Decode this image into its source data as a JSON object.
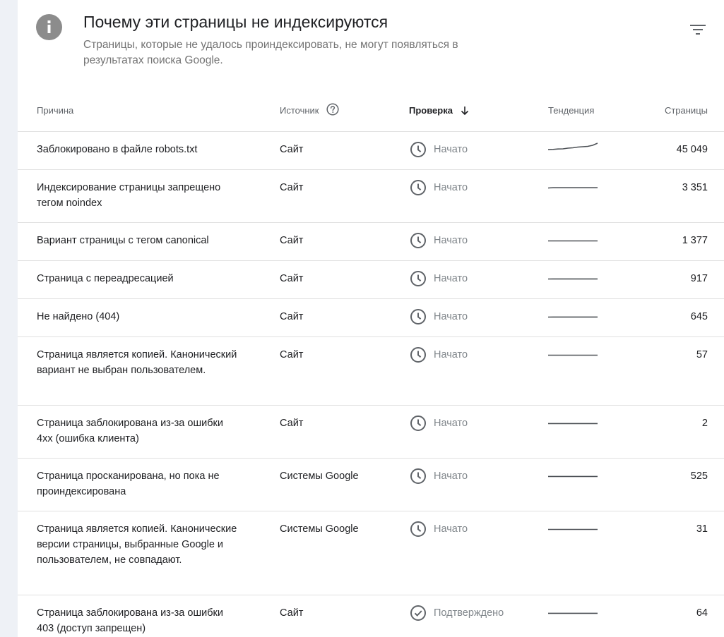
{
  "header": {
    "title": "Почему эти страницы не индексируются",
    "subtitle": "Страницы, которые не удалось проиндексировать, не могут появляться в результатах поиска Google."
  },
  "columns": {
    "reason": "Причина",
    "source": "Источник",
    "check": "Проверка",
    "trend": "Тенденция",
    "pages": "Страницы"
  },
  "colors": {
    "page_bg": "#eef1f6",
    "card_bg": "#ffffff",
    "icon_gray": "#5f6368",
    "trend_line": "#4d5156",
    "divider": "#e0e0e0"
  },
  "rows": [
    {
      "reason": "Заблокировано в файле robots.txt",
      "source": "Сайт",
      "status": "Начато",
      "status_icon": "clock-icon",
      "trend": [
        0.08,
        0.12,
        0.18,
        0.2,
        0.3,
        0.35,
        0.45,
        0.5,
        0.55,
        0.7,
        1.0
      ],
      "pages": "45 049"
    },
    {
      "reason": "Индексирование страницы запрещено тегом noindex",
      "source": "Сайт",
      "status": "Начато",
      "status_icon": "clock-icon",
      "trend": [
        0.05,
        0.1,
        0.1,
        0.1,
        0.1,
        0.1,
        0.1,
        0.1,
        0.1,
        0.1,
        0.1
      ],
      "pages": "3 351"
    },
    {
      "reason": "Вариант страницы с тегом canonical",
      "source": "Сайт",
      "status": "Начато",
      "status_icon": "clock-icon",
      "trend": [
        0.05,
        0.05,
        0.05,
        0.05,
        0.05,
        0.05,
        0.05,
        0.05,
        0.05,
        0.05,
        0.05
      ],
      "pages": "1 377"
    },
    {
      "reason": "Страница с переадресацией",
      "source": "Сайт",
      "status": "Начато",
      "status_icon": "clock-icon",
      "trend": [
        0.05,
        0.06,
        0.06,
        0.06,
        0.06,
        0.06,
        0.06,
        0.06,
        0.06,
        0.06,
        0.06
      ],
      "pages": "917"
    },
    {
      "reason": "Не найдено (404)",
      "source": "Сайт",
      "status": "Начато",
      "status_icon": "clock-icon",
      "trend": [
        0.05,
        0.06,
        0.06,
        0.06,
        0.06,
        0.06,
        0.06,
        0.06,
        0.06,
        0.06,
        0.06
      ],
      "pages": "645"
    },
    {
      "reason": "Страница является копией. Канонический вариант не выбран пользователем.",
      "source": "Сайт",
      "status": "Начато",
      "status_icon": "clock-icon",
      "trend": [
        0.05,
        0.05,
        0.05,
        0.05,
        0.05,
        0.05,
        0.05,
        0.05,
        0.05,
        0.05,
        0.05
      ],
      "pages": "57"
    },
    {
      "reason": "Страница заблокирована из-за ошибки 4xx (ошибка клиента)",
      "source": "Сайт",
      "status": "Начато",
      "status_icon": "clock-icon",
      "trend": [
        0.06,
        0.06,
        0.06,
        0.06,
        0.06,
        0.06,
        0.06,
        0.06,
        0.06,
        0.06,
        0.06
      ],
      "pages": "2"
    },
    {
      "reason": "Страница просканирована, но пока не проиндексирована",
      "source": "Системы Google",
      "status": "Начато",
      "status_icon": "clock-icon",
      "trend": [
        0.06,
        0.06,
        0.06,
        0.06,
        0.06,
        0.06,
        0.06,
        0.06,
        0.06,
        0.06,
        0.06
      ],
      "pages": "525"
    },
    {
      "reason": "Страница является копией. Канонические версии страницы, выбранные Google и пользователем, не совпадают.",
      "source": "Системы Google",
      "status": "Начато",
      "status_icon": "clock-icon",
      "trend": [
        0.05,
        0.05,
        0.05,
        0.05,
        0.05,
        0.05,
        0.05,
        0.05,
        0.05,
        0.05,
        0.05
      ],
      "pages": "31"
    },
    {
      "reason": "Страница заблокирована из-за ошибки 403 (доступ запрещен)",
      "source": "Сайт",
      "status": "Подтверждено",
      "status_icon": "check-circle-icon",
      "trend": [
        0.06,
        0.06,
        0.06,
        0.06,
        0.06,
        0.06,
        0.06,
        0.06,
        0.06,
        0.06,
        0.06
      ],
      "pages": "64"
    }
  ]
}
